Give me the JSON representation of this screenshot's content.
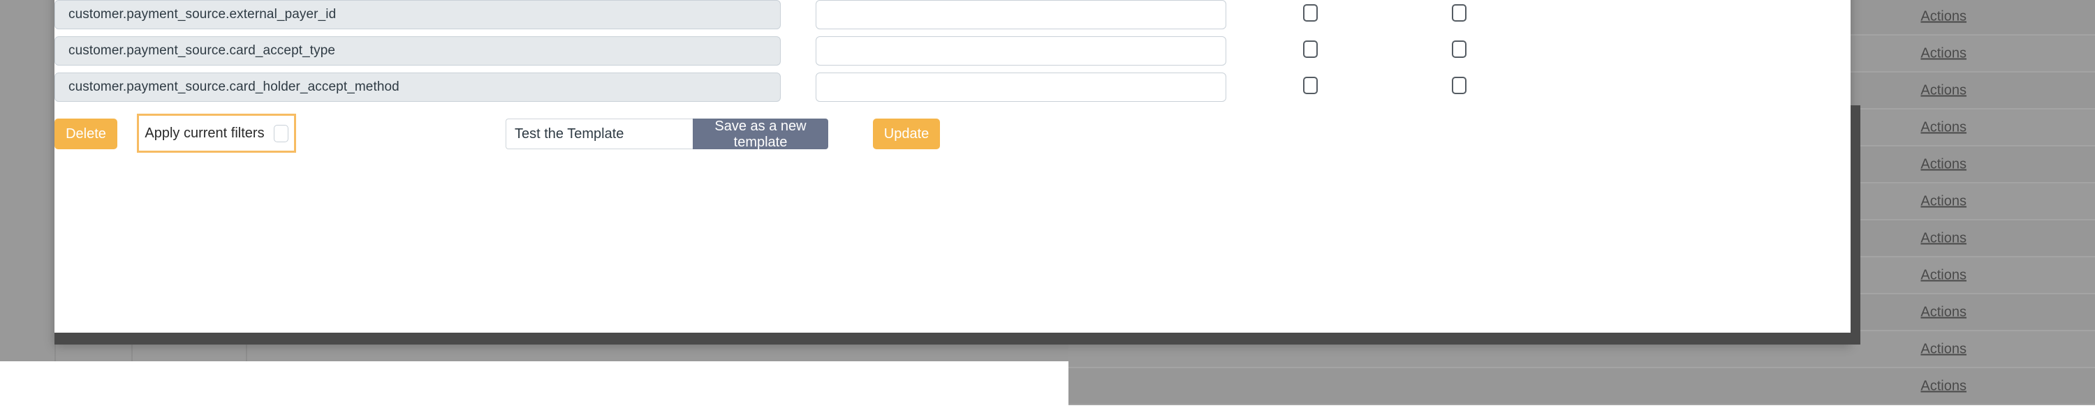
{
  "modal": {
    "fields": [
      {
        "key": "customer.payment_source.external_payer_id",
        "value": "",
        "flag_a": false,
        "flag_b": false
      },
      {
        "key": "customer.payment_source.card_accept_type",
        "value": "",
        "flag_a": false,
        "flag_b": false
      },
      {
        "key": "customer.payment_source.card_holder_accept_method",
        "value": "",
        "flag_a": false,
        "flag_b": false
      }
    ],
    "actions": {
      "delete_label": "Delete",
      "apply_filters_label": "Apply current filters",
      "apply_filters_checked": false,
      "template_name_value": "Test the Template",
      "template_name_placeholder": "Test the Template",
      "save_template_label": "Save as a new template",
      "update_label": "Update"
    }
  },
  "background": {
    "action_link_label": "Actions",
    "rows": [
      {
        "actions": ""
      },
      {
        "actions": "Actions"
      },
      {
        "actions": "Actions"
      },
      {
        "actions": "Actions"
      },
      {
        "actions": "Actions"
      },
      {
        "actions": "Actions"
      },
      {
        "actions": "Actions"
      },
      {
        "actions": "Actions"
      },
      {
        "actions": "Actions"
      },
      {
        "actions": "Actions"
      },
      {
        "actions": "Actions"
      },
      {
        "actions": "Actions"
      }
    ]
  },
  "colors": {
    "accent_orange": "#f5b54a",
    "slate_button": "#6a748c",
    "key_field_bg": "#e5e9ec",
    "overlay": "#999999",
    "scrollbar": "#4a4a4a"
  }
}
